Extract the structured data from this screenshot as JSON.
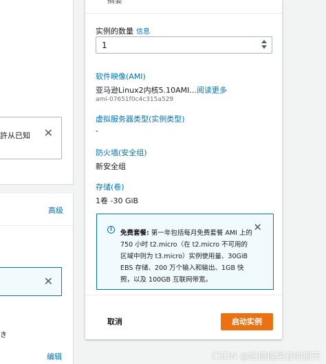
{
  "left": {
    "alert1_text": "許从已知",
    "advanced_label": "高级",
    "edit_label": "编辑",
    "fragment": "き"
  },
  "panel": {
    "header_fragment": "摘要",
    "instances": {
      "label": "实例的数量",
      "info": "信息",
      "value": "1"
    },
    "ami": {
      "title": "软件映像(AMI)",
      "value": "亚马逊Linux2内核5.10AMI...",
      "more_link": "阅读更多",
      "id": "ami-07651f0c4c315a529"
    },
    "instance_type": {
      "title": "虚拟服务器类型(实例类型)",
      "value": "-"
    },
    "firewall": {
      "title": "防火墙(安全组)",
      "value": "新安全组"
    },
    "storage": {
      "title": "存储(卷)",
      "value": "1卷 -30 GiB"
    }
  },
  "info_box": {
    "icon": "info-icon",
    "bold": "免费套餐:",
    "text": " 第一年包括每月免费套餐 AMI 上的 750 小时 t2.micro（在 t2.micro 不可用的区域中则为 t3.micro）实例使用量、30GiB EBS 存储、200 万个输入和输出、1GB 快照，以及 100GB 互联网带宽。"
  },
  "actions": {
    "cancel": "取消",
    "launch": "启动实例"
  },
  "watermark": "CSDN @記憶搖晃着的那天",
  "colors": {
    "accent": "#0073bb",
    "primary_button": "#ec7211"
  }
}
